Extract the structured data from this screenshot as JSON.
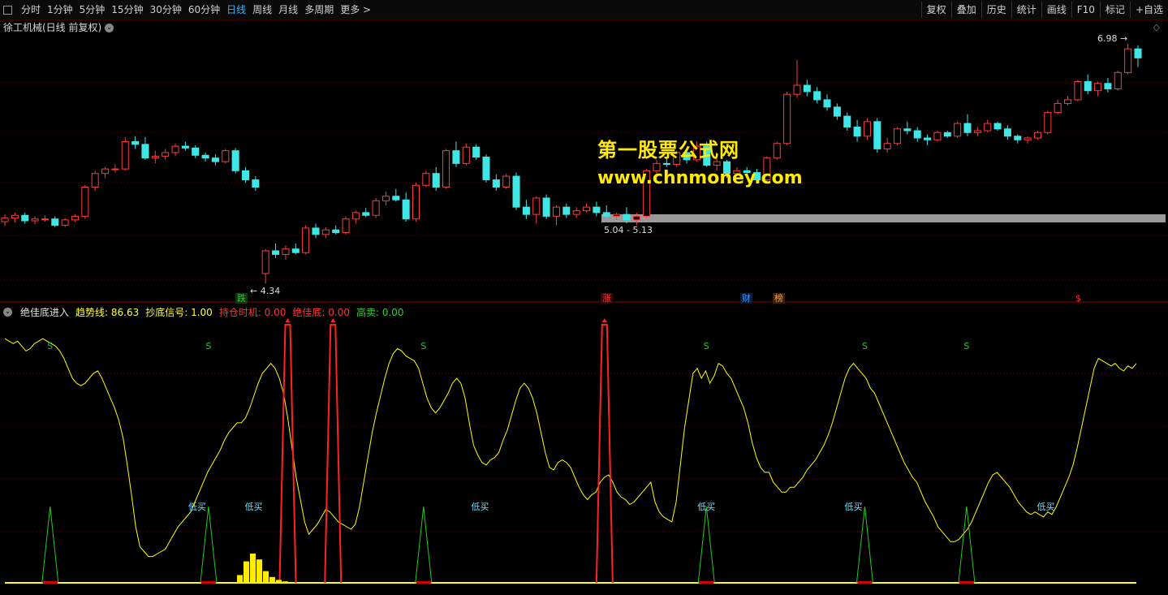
{
  "toolbar": {
    "periods": [
      "分时",
      "1分钟",
      "5分钟",
      "15分钟",
      "30分钟",
      "60分钟",
      "日线",
      "周线",
      "月线",
      "多周期",
      "更多 >"
    ],
    "active_period": "日线",
    "tools": [
      "复权",
      "叠加",
      "历史",
      "统计",
      "画线",
      "F10",
      "标记",
      "+自选"
    ]
  },
  "main_chart": {
    "title": "徐工机械(日线 前复权)",
    "high_label": "6.98",
    "low_label": "4.34",
    "range_label": "5.04 - 5.13",
    "watermark_cn": "第一股票公式网",
    "watermark_url": "www.chnmoney.com",
    "event_labels": [
      {
        "text": "跌",
        "color": "#22cc22"
      },
      {
        "text": "涨",
        "color": "#ff3333"
      },
      {
        "text": "财",
        "color": "#3399ff"
      },
      {
        "text": "榜",
        "color": "#ff9933"
      },
      {
        "text": "$",
        "color": "#ff3333"
      }
    ]
  },
  "indicator": {
    "name": "绝佳底进入",
    "items": [
      {
        "label": "趋势线: 86.63",
        "color": "#ffff33"
      },
      {
        "label": "抄底信号: 1.00",
        "color": "#ffff33"
      },
      {
        "label": "持仓时机: 0.00",
        "color": "#ff3333"
      },
      {
        "label": "绝佳底: 0.00",
        "color": "#ff3333"
      },
      {
        "label": "高卖: 0.00",
        "color": "#33cc33"
      }
    ],
    "s_marks": [
      "S",
      "S",
      "S",
      "S",
      "S"
    ],
    "low_buy_label": "低买"
  },
  "colors": {
    "up": "#ff3c3c",
    "down": "#3ee6e6",
    "trend": "#ffff00",
    "grid": "#5a0000"
  },
  "chart_data": {
    "type": "candlestick",
    "candles": [
      [
        5.02,
        5.1,
        4.97,
        5.06
      ],
      [
        5.06,
        5.12,
        5.01,
        5.09
      ],
      [
        5.09,
        5.12,
        5.0,
        5.03
      ],
      [
        5.03,
        5.08,
        4.99,
        5.05
      ],
      [
        5.05,
        5.09,
        5.02,
        5.05
      ],
      [
        5.05,
        5.08,
        4.96,
        4.98
      ],
      [
        4.98,
        5.06,
        4.96,
        5.04
      ],
      [
        5.04,
        5.1,
        5.02,
        5.08
      ],
      [
        5.08,
        5.42,
        5.05,
        5.4
      ],
      [
        5.4,
        5.58,
        5.36,
        5.55
      ],
      [
        5.55,
        5.62,
        5.5,
        5.6
      ],
      [
        5.6,
        5.65,
        5.56,
        5.6
      ],
      [
        5.6,
        5.95,
        5.58,
        5.9
      ],
      [
        5.9,
        5.96,
        5.82,
        5.87
      ],
      [
        5.87,
        5.95,
        5.7,
        5.72
      ],
      [
        5.72,
        5.8,
        5.66,
        5.74
      ],
      [
        5.74,
        5.82,
        5.7,
        5.78
      ],
      [
        5.78,
        5.88,
        5.74,
        5.85
      ],
      [
        5.85,
        5.9,
        5.8,
        5.83
      ],
      [
        5.83,
        5.86,
        5.72,
        5.75
      ],
      [
        5.75,
        5.78,
        5.68,
        5.72
      ],
      [
        5.72,
        5.76,
        5.64,
        5.68
      ],
      [
        5.68,
        5.82,
        5.66,
        5.8
      ],
      [
        5.8,
        5.83,
        5.55,
        5.58
      ],
      [
        5.58,
        5.62,
        5.45,
        5.48
      ],
      [
        5.48,
        5.52,
        5.36,
        5.4
      ],
      [
        4.45,
        4.72,
        4.34,
        4.7
      ],
      [
        4.7,
        4.78,
        4.62,
        4.66
      ],
      [
        4.66,
        4.76,
        4.6,
        4.72
      ],
      [
        4.72,
        4.78,
        4.66,
        4.68
      ],
      [
        4.68,
        4.98,
        4.66,
        4.95
      ],
      [
        4.95,
        5.0,
        4.84,
        4.88
      ],
      [
        4.88,
        4.96,
        4.84,
        4.93
      ],
      [
        4.93,
        4.98,
        4.88,
        4.9
      ],
      [
        4.9,
        5.08,
        4.88,
        5.05
      ],
      [
        5.05,
        5.14,
        5.0,
        5.12
      ],
      [
        5.12,
        5.17,
        5.07,
        5.09
      ],
      [
        5.09,
        5.28,
        5.06,
        5.25
      ],
      [
        5.25,
        5.35,
        5.2,
        5.3
      ],
      [
        5.3,
        5.38,
        5.24,
        5.26
      ],
      [
        5.26,
        5.34,
        5.02,
        5.05
      ],
      [
        5.05,
        5.45,
        5.02,
        5.42
      ],
      [
        5.42,
        5.58,
        5.4,
        5.55
      ],
      [
        5.55,
        5.62,
        5.36,
        5.4
      ],
      [
        5.4,
        5.82,
        5.38,
        5.8
      ],
      [
        5.8,
        5.9,
        5.62,
        5.66
      ],
      [
        5.66,
        5.88,
        5.64,
        5.84
      ],
      [
        5.84,
        5.87,
        5.7,
        5.73
      ],
      [
        5.73,
        5.76,
        5.45,
        5.48
      ],
      [
        5.48,
        5.54,
        5.36,
        5.4
      ],
      [
        5.4,
        5.55,
        5.38,
        5.52
      ],
      [
        5.52,
        5.56,
        5.15,
        5.18
      ],
      [
        5.18,
        5.26,
        5.05,
        5.1
      ],
      [
        5.1,
        5.3,
        5.0,
        5.28
      ],
      [
        5.28,
        5.32,
        5.05,
        5.08
      ],
      [
        5.08,
        5.2,
        4.98,
        5.18
      ],
      [
        5.18,
        5.22,
        5.06,
        5.1
      ],
      [
        5.1,
        5.18,
        5.06,
        5.14
      ],
      [
        5.14,
        5.22,
        5.12,
        5.18
      ],
      [
        5.18,
        5.24,
        5.08,
        5.12
      ],
      [
        5.12,
        5.2,
        5.06,
        5.08
      ],
      [
        5.08,
        5.12,
        5.04,
        5.1
      ],
      [
        5.1,
        5.18,
        5.0,
        5.04
      ],
      [
        5.04,
        5.12,
        4.98,
        5.08
      ],
      [
        5.08,
        5.6,
        5.06,
        5.58
      ],
      [
        5.58,
        5.7,
        5.55,
        5.66
      ],
      [
        5.66,
        5.72,
        5.62,
        5.65
      ],
      [
        5.65,
        5.8,
        5.62,
        5.78
      ],
      [
        5.78,
        5.82,
        5.66,
        5.7
      ],
      [
        5.7,
        5.9,
        5.68,
        5.85
      ],
      [
        5.85,
        5.9,
        5.62,
        5.64
      ],
      [
        5.64,
        5.72,
        5.58,
        5.68
      ],
      [
        5.68,
        5.7,
        5.5,
        5.55
      ],
      [
        5.55,
        5.62,
        5.52,
        5.58
      ],
      [
        5.58,
        5.62,
        5.54,
        5.56
      ],
      [
        5.56,
        5.6,
        5.44,
        5.48
      ],
      [
        5.48,
        5.74,
        5.46,
        5.72
      ],
      [
        5.72,
        5.9,
        5.7,
        5.88
      ],
      [
        5.88,
        6.45,
        5.86,
        6.42
      ],
      [
        6.42,
        6.8,
        6.38,
        6.52
      ],
      [
        6.52,
        6.58,
        6.4,
        6.45
      ],
      [
        6.45,
        6.5,
        6.32,
        6.36
      ],
      [
        6.36,
        6.42,
        6.24,
        6.28
      ],
      [
        6.28,
        6.32,
        6.14,
        6.18
      ],
      [
        6.18,
        6.22,
        6.02,
        6.06
      ],
      [
        6.06,
        6.14,
        5.9,
        5.96
      ],
      [
        5.96,
        6.16,
        5.92,
        6.12
      ],
      [
        6.12,
        6.16,
        5.78,
        5.82
      ],
      [
        5.82,
        5.94,
        5.78,
        5.88
      ],
      [
        5.88,
        6.06,
        5.86,
        6.04
      ],
      [
        6.04,
        6.12,
        5.98,
        6.02
      ],
      [
        6.02,
        6.06,
        5.9,
        5.94
      ],
      [
        5.94,
        5.98,
        5.86,
        5.92
      ],
      [
        5.92,
        6.02,
        5.9,
        6.0
      ],
      [
        6.0,
        6.02,
        5.94,
        5.96
      ],
      [
        5.96,
        6.12,
        5.94,
        6.1
      ],
      [
        6.1,
        6.2,
        5.96,
        6.0
      ],
      [
        6.0,
        6.06,
        5.96,
        6.02
      ],
      [
        6.02,
        6.14,
        6.0,
        6.1
      ],
      [
        6.1,
        6.12,
        6.02,
        6.04
      ],
      [
        6.04,
        6.08,
        5.92,
        5.96
      ],
      [
        5.96,
        5.98,
        5.88,
        5.92
      ],
      [
        5.92,
        5.96,
        5.88,
        5.94
      ],
      [
        5.94,
        6.02,
        5.92,
        6.0
      ],
      [
        6.0,
        6.24,
        5.98,
        6.22
      ],
      [
        6.22,
        6.36,
        6.2,
        6.32
      ],
      [
        6.32,
        6.4,
        6.3,
        6.36
      ],
      [
        6.36,
        6.58,
        6.34,
        6.56
      ],
      [
        6.56,
        6.64,
        6.42,
        6.46
      ],
      [
        6.46,
        6.56,
        6.4,
        6.54
      ],
      [
        6.54,
        6.6,
        6.44,
        6.48
      ],
      [
        6.48,
        6.68,
        6.46,
        6.66
      ],
      [
        6.66,
        6.98,
        6.64,
        6.92
      ],
      [
        6.92,
        6.96,
        6.72,
        6.82
      ]
    ],
    "trend_line": [
      96,
      95,
      94,
      95,
      93,
      91,
      92,
      94,
      95,
      96,
      95,
      94,
      93,
      91,
      88,
      84,
      80,
      78,
      77,
      78,
      80,
      82,
      83,
      80,
      76,
      72,
      68,
      63,
      56,
      45,
      33,
      20,
      12,
      10,
      8,
      8,
      9,
      10,
      11,
      14,
      17,
      20,
      22,
      24,
      26,
      30,
      34,
      38,
      42,
      45,
      48,
      51,
      55,
      58,
      60,
      62,
      62,
      64,
      68,
      73,
      78,
      82,
      84,
      86,
      84,
      80,
      74,
      64,
      52,
      40,
      31,
      22,
      17,
      19,
      21,
      24,
      27,
      26,
      24,
      22,
      21,
      20,
      19,
      21,
      28,
      38,
      48,
      58,
      66,
      73,
      80,
      86,
      90,
      92,
      91,
      89,
      88,
      87,
      84,
      78,
      72,
      68,
      66,
      68,
      71,
      74,
      78,
      80,
      78,
      72,
      62,
      53,
      49,
      46,
      45,
      47,
      48,
      50,
      55,
      59,
      65,
      71,
      76,
      78,
      76,
      72,
      66,
      58,
      50,
      44,
      43,
      46,
      47,
      46,
      44,
      40,
      36,
      33,
      31,
      33,
      34,
      38,
      40,
      41,
      38,
      34,
      32,
      31,
      29,
      30,
      32,
      34,
      36,
      38,
      30,
      26,
      24,
      23,
      22,
      30,
      45,
      60,
      71,
      82,
      84,
      80,
      83,
      78,
      81,
      86,
      85,
      82,
      80,
      76,
      72,
      68,
      62,
      54,
      48,
      44,
      42,
      42,
      38,
      36,
      34,
      34,
      36,
      36,
      38,
      40,
      43,
      45,
      47,
      50,
      53,
      57,
      62,
      68,
      74,
      80,
      84,
      86,
      84,
      82,
      80,
      76,
      74,
      70,
      66,
      62,
      58,
      54,
      50,
      46,
      43,
      40,
      38,
      34,
      30,
      27,
      24,
      20,
      18,
      16,
      14,
      14,
      15,
      17,
      19,
      22,
      26,
      30,
      34,
      38,
      41,
      42,
      40,
      38,
      36,
      33,
      30,
      28,
      26,
      25,
      26,
      25,
      24,
      26,
      25,
      28,
      32,
      36,
      40,
      45,
      52,
      60,
      68,
      76,
      84,
      88,
      87,
      86,
      85,
      86,
      84,
      83,
      85,
      84,
      86
    ],
    "sell_spikes": [
      0.04,
      0.18,
      0.37,
      0.62,
      0.76,
      0.85
    ],
    "hold_spikes": [
      0.25,
      0.29,
      0.53
    ],
    "low_buy_positions": [
      0.17,
      0.22,
      0.42,
      0.62,
      0.75,
      0.92
    ],
    "bottom_bars": [
      0.8,
      2.2,
      3.0,
      2.4,
      1.2,
      0.6,
      0.3,
      0.15
    ],
    "y_range": [
      4.2,
      7.1
    ]
  }
}
